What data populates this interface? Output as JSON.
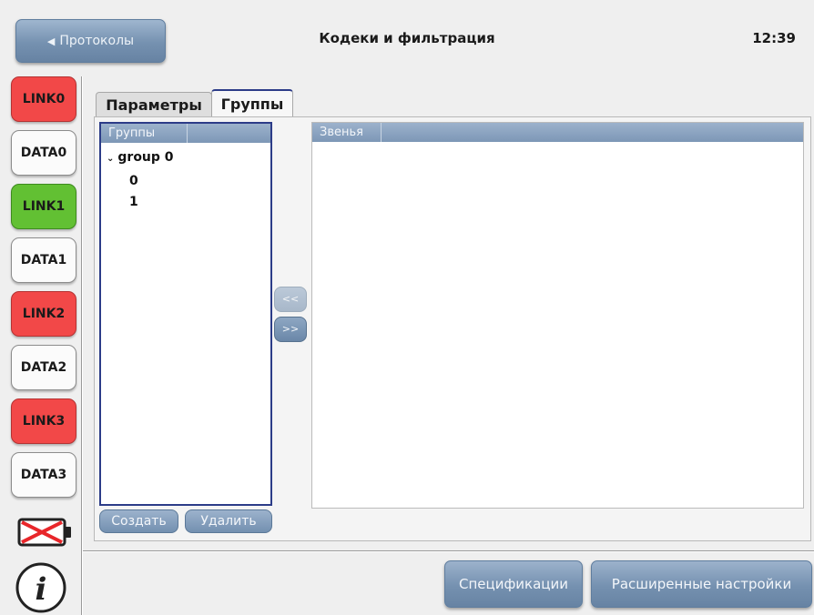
{
  "header": {
    "back_label": "Протоколы",
    "title": "Кодеки и фильтрация",
    "time": "12:39"
  },
  "ports": [
    {
      "label": "LINK0",
      "status": "red"
    },
    {
      "label": "DATA0",
      "status": "white"
    },
    {
      "label": "LINK1",
      "status": "green"
    },
    {
      "label": "DATA1",
      "status": "white"
    },
    {
      "label": "LINK2",
      "status": "red"
    },
    {
      "label": "DATA2",
      "status": "white"
    },
    {
      "label": "LINK3",
      "status": "red"
    },
    {
      "label": "DATA3",
      "status": "white"
    }
  ],
  "tabs": [
    {
      "label": "Параметры",
      "active": false
    },
    {
      "label": "Группы",
      "active": true
    }
  ],
  "groups_panel": {
    "header": "Группы",
    "tree": {
      "name": "group 0",
      "expanded": true,
      "children": [
        "0",
        "1"
      ]
    }
  },
  "links_panel": {
    "header": "Звенья",
    "rows": []
  },
  "transfer": {
    "left_label": "<<",
    "right_label": ">>"
  },
  "group_actions": {
    "create_label": "Создать",
    "delete_label": "Удалить"
  },
  "footer": {
    "spec_label": "Спецификации",
    "advanced_label": "Расширенные настройки"
  },
  "colors": {
    "accent": "#7d97b6",
    "link_red": "#f24848",
    "link_green": "#62c033",
    "selection_border": "#2c3c88"
  },
  "icons": {
    "battery": "battery-empty-icon",
    "info": "info-icon"
  }
}
